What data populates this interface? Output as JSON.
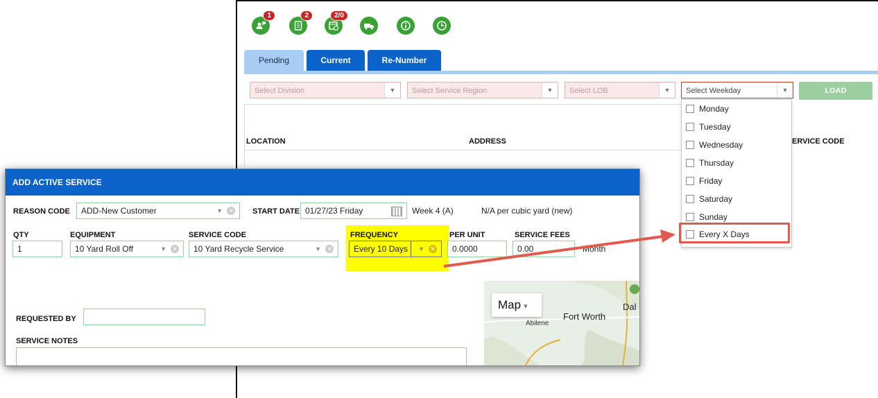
{
  "toolbar": {
    "icons": [
      {
        "name": "chat-user-icon",
        "badge": "1"
      },
      {
        "name": "document-icon",
        "badge": "2"
      },
      {
        "name": "calendar-clock-icon",
        "badge": "2/0"
      },
      {
        "name": "truck-icon",
        "badge": ""
      },
      {
        "name": "info-icon",
        "badge": ""
      },
      {
        "name": "clock-icon",
        "badge": ""
      }
    ]
  },
  "tabs": {
    "pending": "Pending",
    "current": "Current",
    "renumber": "Re-Number"
  },
  "filters": {
    "division": "Select Division",
    "service_region": "Select Service Region",
    "lob": "Select LOB",
    "weekday": "Select Weekday",
    "load": "LOAD"
  },
  "table": {
    "location": "LOCATION",
    "address": "ADDRESS",
    "service_code": "ERVICE CODE"
  },
  "weekday_options": [
    "Monday",
    "Tuesday",
    "Wednesday",
    "Thursday",
    "Friday",
    "Saturday",
    "Sunday",
    "Every X Days"
  ],
  "modal": {
    "title": "ADD ACTIVE SERVICE",
    "reason_code_label": "REASON CODE",
    "reason_code_value": "ADD-New Customer",
    "start_date_label": "START DATE",
    "start_date_value": "01/27/23 Friday",
    "week_text": "Week 4 (A)",
    "per_unit_note": "N/A per cubic yard (new)",
    "qty_label": "QTY",
    "qty_value": "1",
    "equipment_label": "EQUIPMENT",
    "equipment_value": "10 Yard Roll Off",
    "service_code_label": "SERVICE CODE",
    "service_code_value": "10 Yard Recycle Service",
    "frequency_label": "FREQUENCY",
    "frequency_value": "Every 10 Days",
    "per_unit_label": "PER UNIT",
    "per_unit_value": "0.0000",
    "service_fees_label": "SERVICE FEES",
    "service_fees_value": "0.00",
    "month_text": "Month",
    "requested_by_label": "REQUESTED BY",
    "requested_by_value": "",
    "service_notes_label": "SERVICE NOTES"
  },
  "map": {
    "button": "Map",
    "city1": "Abilene",
    "city2": "Fort Worth",
    "city3": "Dal"
  },
  "colors": {
    "primary_blue": "#0b62c9",
    "green": "#3aa135",
    "highlight_yellow": "#ffff00",
    "annotation_red": "#e05a4e"
  }
}
